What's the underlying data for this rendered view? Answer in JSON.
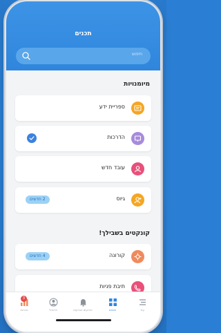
{
  "header": {
    "title": "תכנים"
  },
  "search": {
    "placeholder": "חיפוש"
  },
  "sections": [
    {
      "title": "מיומנויות"
    },
    {
      "title": "קונקטים בשבילך!"
    }
  ],
  "cards": [
    {
      "label": "ספריית ידע",
      "icon": "library-icon",
      "color": "#f5a623"
    },
    {
      "label": "הדרכות",
      "icon": "training-icon",
      "color": "#a78bdb",
      "completed": true
    },
    {
      "label": "עובד חדש",
      "icon": "new-employee-icon",
      "color": "#e8507a"
    },
    {
      "label": "גיוס",
      "icon": "recruitment-icon",
      "color": "#f5a623",
      "badge": "2 חדשים"
    },
    {
      "label": "קורונה",
      "icon": "corona-icon",
      "color": "#f08a5d",
      "badge": "4 חדשים"
    },
    {
      "label": "תיבת פניות",
      "icon": "inbox-icon",
      "color": "#e8507a"
    }
  ],
  "tabbar": {
    "tabs": [
      {
        "label": "נוכחות",
        "icon": "chart-icon",
        "badge": "3"
      },
      {
        "label": "פרופיל",
        "icon": "profile-icon"
      },
      {
        "label": "אירועים והודעות",
        "icon": "bell-icon"
      },
      {
        "label": "תכנים",
        "icon": "grid-icon",
        "active": true
      },
      {
        "label": "עוד",
        "icon": "menu-icon"
      }
    ]
  },
  "colors": {
    "accent": "#2f86dc",
    "header": "#3d94e6",
    "badge_bg": "#9cd1f5",
    "notif": "#e24a4a"
  }
}
